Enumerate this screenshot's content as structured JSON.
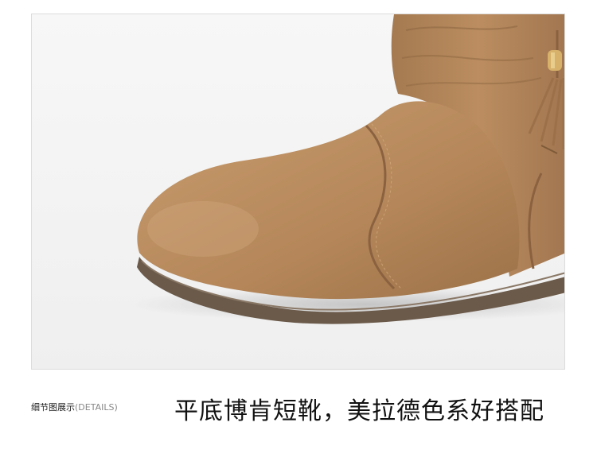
{
  "caption": {
    "label_cn": "细节图展示",
    "label_en": "(DETAILS)"
  },
  "headline": "平底博肯短靴，美拉德色系好搭配",
  "photo": {
    "subject": "boot-toe-closeup",
    "colors": {
      "background": "#f4f4f4",
      "suede": "#b88a5e",
      "suede_shadow": "#8f6640",
      "suede_highlight": "#c89c6f",
      "sole": "#6b5a4a",
      "bead": "#d7b16a"
    }
  }
}
